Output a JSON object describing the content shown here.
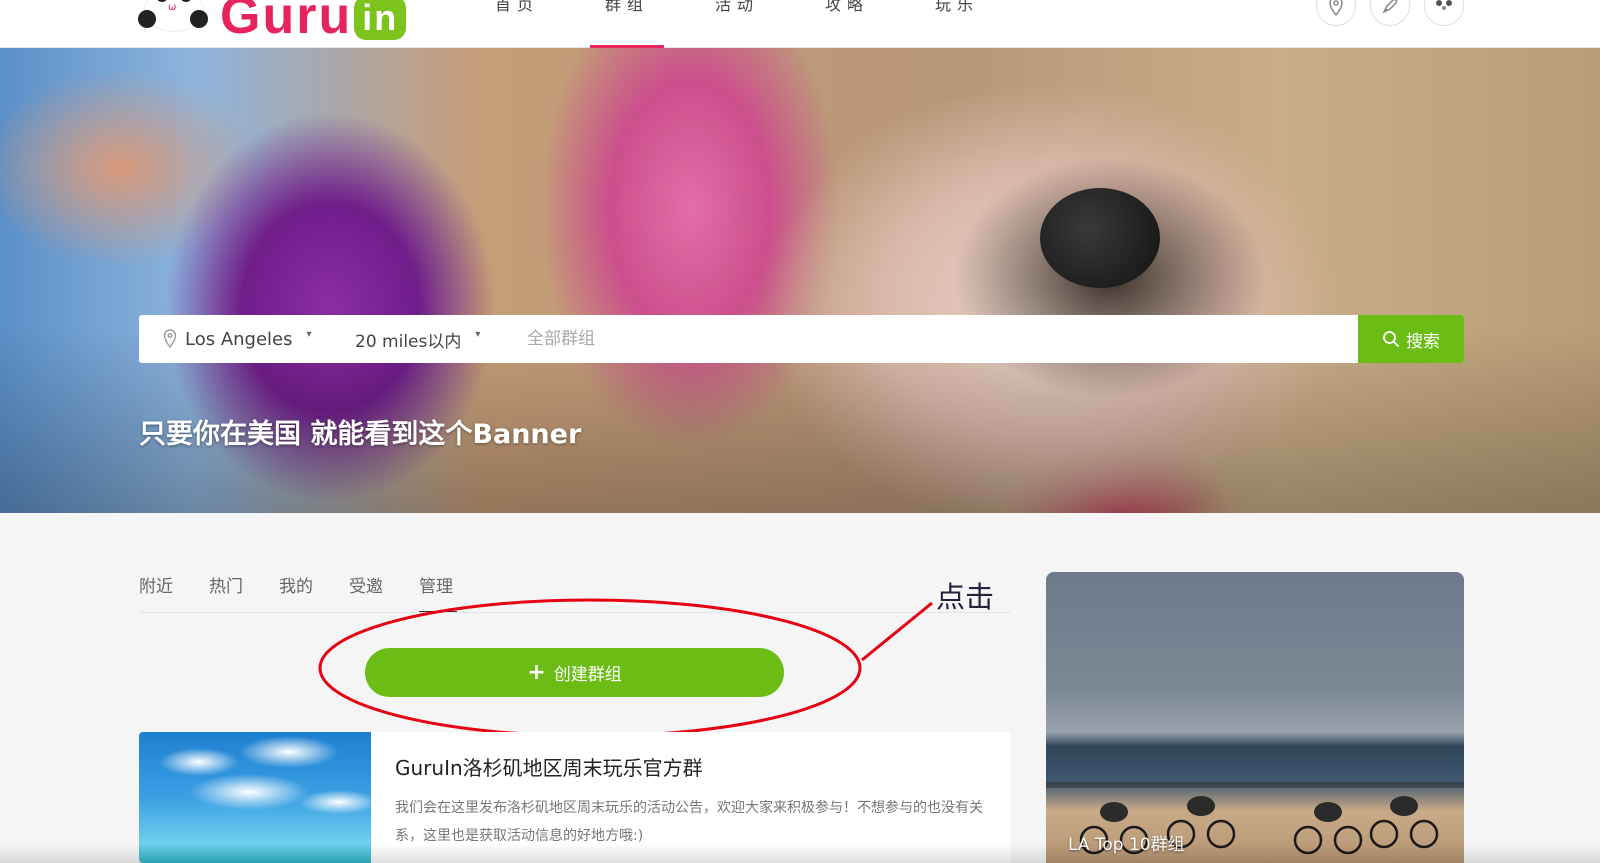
{
  "header": {
    "brand": "Guru",
    "brand_badge": "in",
    "nav": [
      {
        "label": "首页",
        "active": false
      },
      {
        "label": "群组",
        "active": true
      },
      {
        "label": "活动",
        "active": false
      },
      {
        "label": "攻略",
        "active": false
      },
      {
        "label": "玩乐",
        "active": false
      }
    ],
    "icons": [
      "location-icon",
      "rocket-icon",
      "avatar"
    ]
  },
  "banner": {
    "search": {
      "location": "Los Angeles",
      "distance": "20 miles以内",
      "placeholder": "全部群组",
      "button_label": "搜索"
    },
    "title": "只要你在美国 就能看到这个Banner"
  },
  "tabs": [
    {
      "label": "附近",
      "active": false
    },
    {
      "label": "热门",
      "active": false
    },
    {
      "label": "我的",
      "active": false
    },
    {
      "label": "受邀",
      "active": false
    },
    {
      "label": "管理",
      "active": true
    }
  ],
  "create_button": {
    "label": "创建群组"
  },
  "annotation": {
    "text": "点击",
    "color": "#e60012"
  },
  "group": {
    "title": "GuruIn洛杉矶地区周末玩乐官方群",
    "description": "我们会在这里发布洛杉矶地区周末玩乐的活动公告，欢迎大家来积极参与！不想参与的也没有关系，这里也是获取活动信息的好地方哦:)"
  },
  "top_card": {
    "label": "LA Top 10群组"
  },
  "colors": {
    "accent_green": "#6bbd16",
    "brand_pink": "#e8245f"
  }
}
